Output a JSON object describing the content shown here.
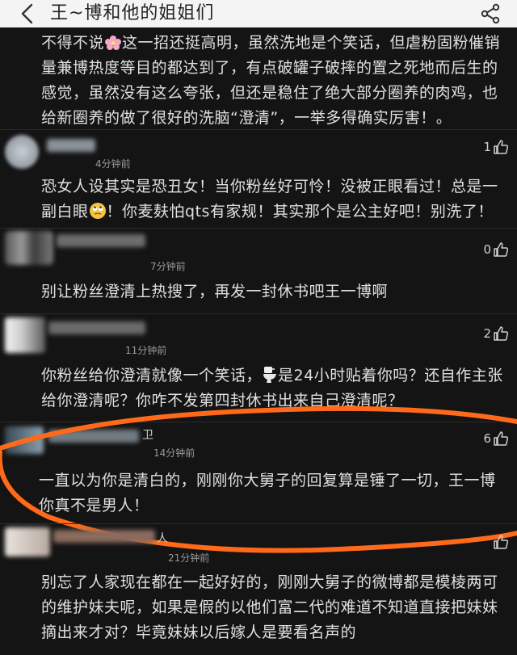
{
  "header": {
    "title": "王~博和他的姐姐们",
    "back_icon": "back-arrow-icon",
    "share_icon": "share-icon"
  },
  "top_comment": {
    "text_before_emoji": "不得不说",
    "text_after_emoji": "这一招还挺高明，虽然洗地是个笑话，但虐粉固粉催销量兼博热度等目的都达到了，有点破罐子破摔的置之死地而后生的感觉，虽然没有这么夸张，但还是稳住了绝大部分圈养的肉鸡，也给新圈养的做了很好的洗脑“澄清”，一举多得确实厉害！。",
    "emoji": "flower-emoji"
  },
  "comments": [
    {
      "time": "4分钟前",
      "likes": "1",
      "text_before_emoji": "恐女人设其实是恐丑女！当你粉丝好可怜！没被正眼看过！总是一副白眼",
      "emoji": "eye-roll-emoji",
      "text_after_emoji": "！你麦麸怕qts有家规！其实那个是公主好吧！别洗了！"
    },
    {
      "time": "7分钟前",
      "likes": "0",
      "text": "别让粉丝澄清上热搜了，再发一封休书吧王一博啊"
    },
    {
      "time": "11分钟前",
      "likes": "2",
      "text_before_emoji": "你粉丝给你澄清就像一个笑话，",
      "emoji": "toilet-emoji",
      "text_after_emoji": "是24小时贴着你吗？还自作主张给你澄清呢？你咋不发第四封休书出来自己澄清呢？"
    },
    {
      "time": "14分钟前",
      "likes": "6",
      "name_fragment": "卫",
      "text": "一直以为你是清白的，刚刚你大舅子的回复算是锤了一切，王一博你真不是男人！",
      "highlight_color": "#ff6a1a"
    },
    {
      "time": "21分钟前",
      "likes": "",
      "name_fragment": "人",
      "text": "别忘了人家现在都在一起好好的，刚刚大舅子的微博都是模棱两可的维护妹夫呢，如果是假的以他们富二代的难道不知道直接把妹妹摘出来才对？毕竟妹妹以后嫁人是要看名声的"
    }
  ]
}
